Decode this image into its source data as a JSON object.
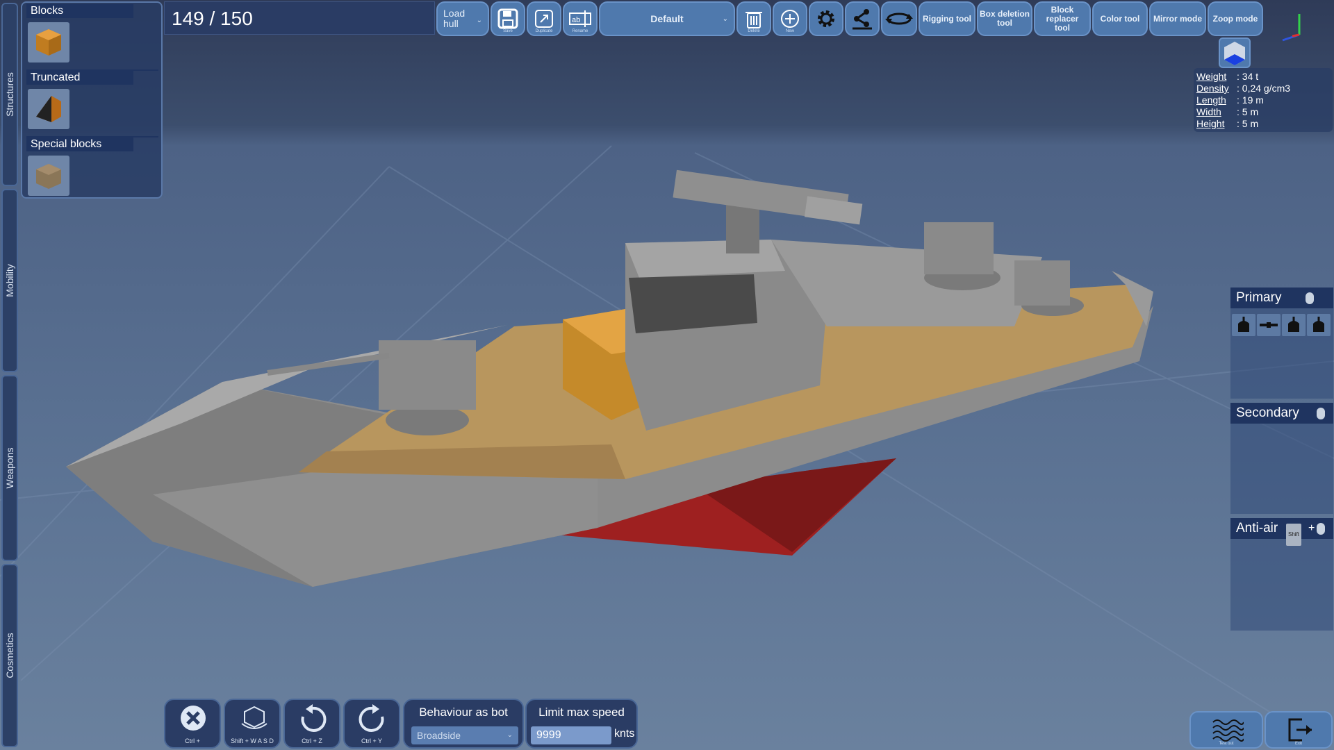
{
  "left_tabs": [
    "Structures",
    "Mobility",
    "Weapons",
    "Cosmetics"
  ],
  "palette": {
    "sections": [
      {
        "title": "Blocks"
      },
      {
        "title": "Truncated"
      },
      {
        "title": "Special blocks"
      }
    ]
  },
  "counter": "149 / 150",
  "toolbar": {
    "load_hull": "Load hull",
    "save_label": "Save",
    "duplicate_label": "Duplicate",
    "rename_label": "Rename",
    "preset": "Default",
    "delete_label": "Delete",
    "new_label": "New",
    "rigging": "Rigging tool",
    "box_deletion": "Box deletion tool",
    "block_replacer": "Block replacer tool",
    "color": "Color tool",
    "mirror": "Mirror mode",
    "zoop": "Zoop mode"
  },
  "info": {
    "weight_key": "Weight",
    "weight_val": ": 34 t",
    "density_key": "Density",
    "density_val": ": 0,24 g/cm3",
    "length_key": "Length",
    "length_val": ": 19 m",
    "width_key": "Width",
    "width_val": ": 5 m",
    "height_key": "Height",
    "height_val": ": 5 m"
  },
  "weapon_groups": {
    "primary": "Primary",
    "secondary": "Secondary",
    "anti_air": "Anti-air",
    "shift_key": "Shift"
  },
  "bottom": {
    "cancel_keys": "Ctrl + ",
    "camera_keys": "Shift + W A S D",
    "undo_keys": "Ctrl + Z",
    "redo_keys": "Ctrl + Y",
    "behaviour_title": "Behaviour as bot",
    "behaviour_value": "Broadside",
    "speed_title": "Limit max speed",
    "speed_value": "9999",
    "speed_unit": "knts",
    "test_label": "Test out",
    "exit_label": "Exit"
  },
  "colors": {
    "hull": "#8c8c8c",
    "deck": "#b8965e",
    "keel": "#b02a2a",
    "ui_button": "#4f79ad",
    "ui_panel": "#2a3c64"
  }
}
